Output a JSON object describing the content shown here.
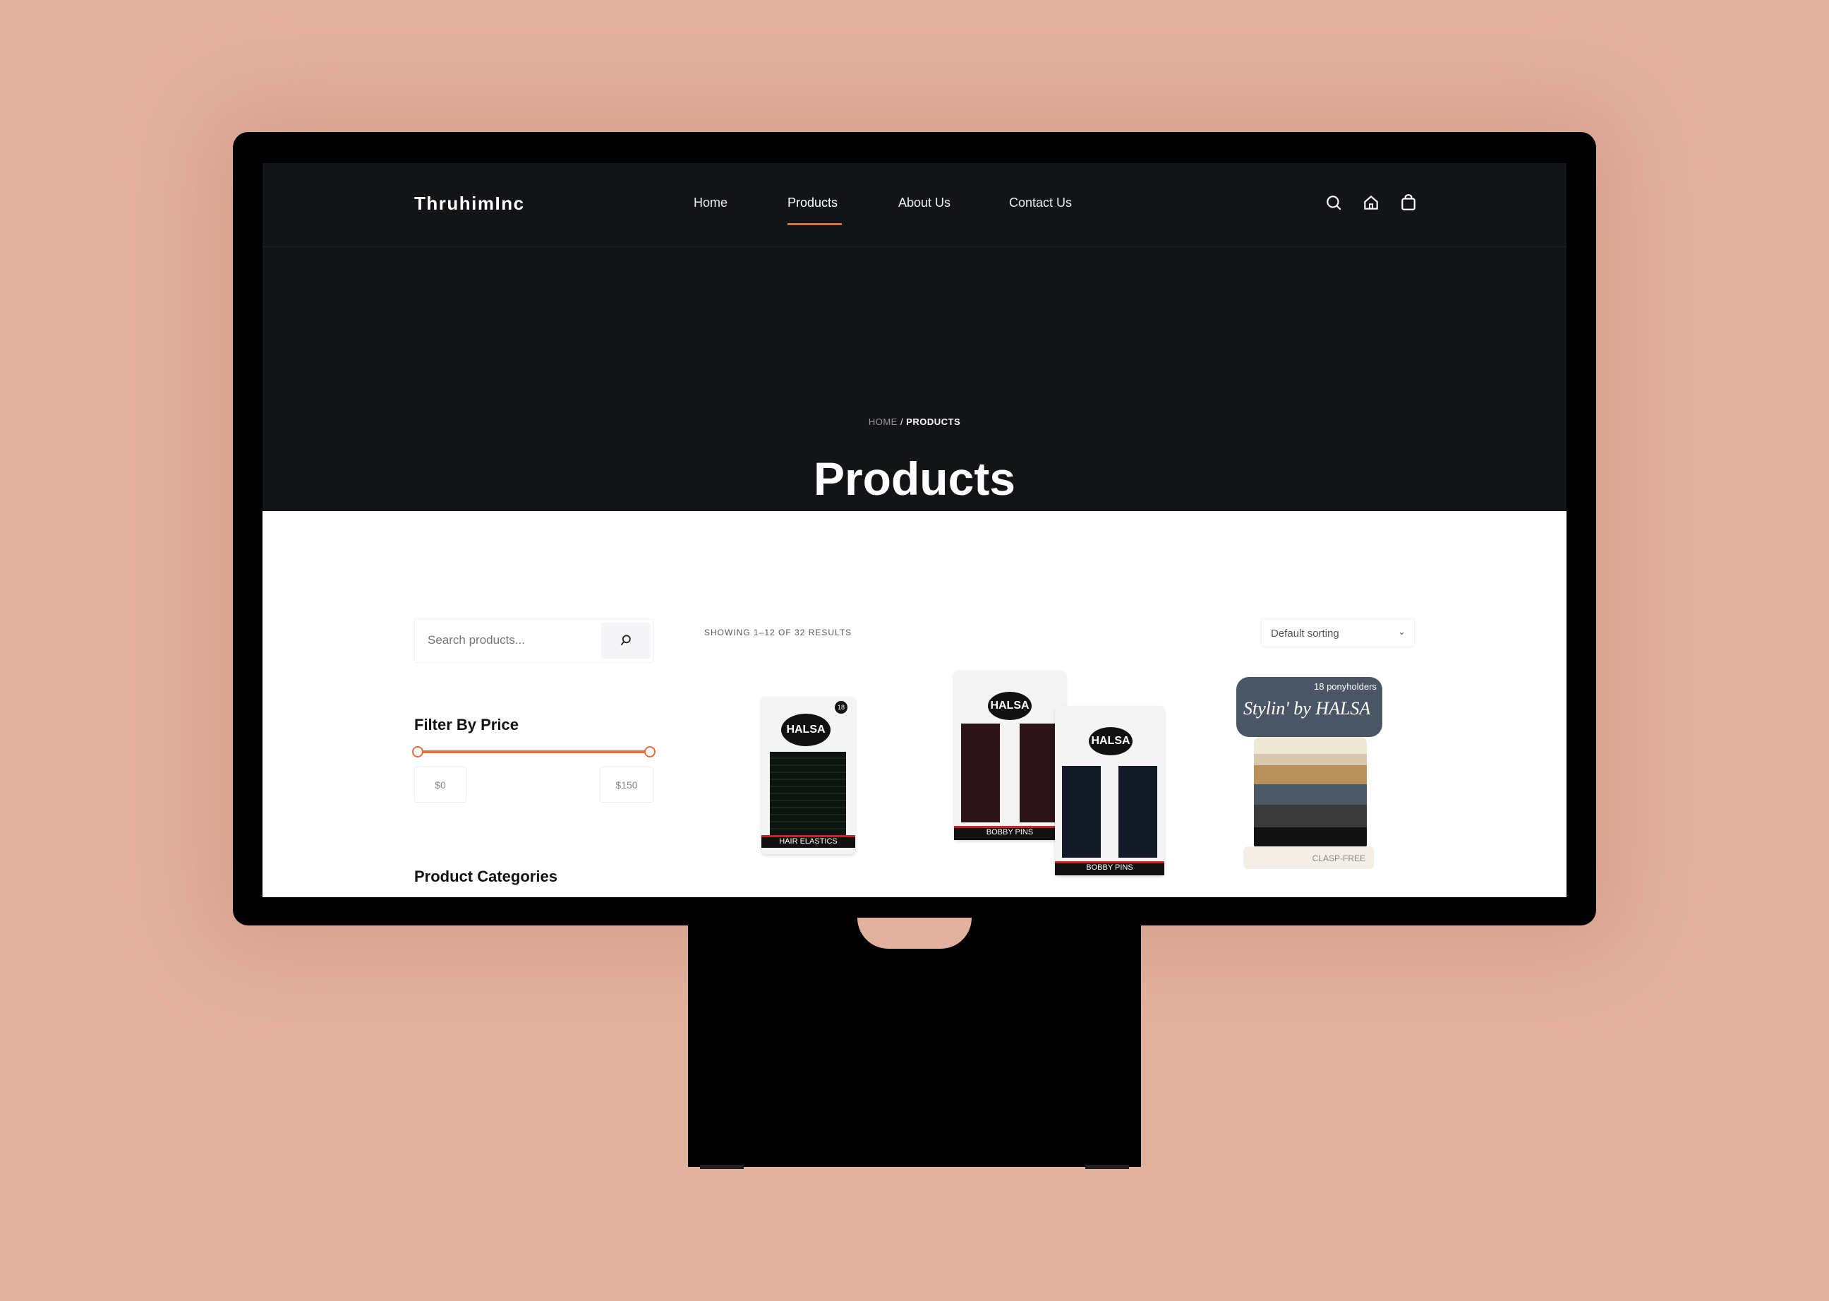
{
  "brand": "ThruhimInc",
  "nav": [
    {
      "label": "Home"
    },
    {
      "label": "Products",
      "active": true
    },
    {
      "label": "About Us"
    },
    {
      "label": "Contact Us"
    }
  ],
  "header_icons": [
    "search-icon",
    "home-icon",
    "shopping-bag-icon"
  ],
  "breadcrumb": {
    "home": "HOME",
    "sep": "/",
    "current": "PRODUCTS"
  },
  "page_title": "Products",
  "sidebar": {
    "search_placeholder": "Search products...",
    "filter_title": "Filter By Price",
    "price_min": "$0",
    "price_max": "$150",
    "categories_title": "Product Categories"
  },
  "results": "SHOWING 1–12 OF 32 RESULTS",
  "sort": {
    "selected": "Default sorting"
  },
  "products": [
    {
      "brand": "HALSA",
      "label": "HAIR ELASTICS",
      "count": "18"
    },
    {
      "brand": "HALSA",
      "label": "BOBBY PINS"
    },
    {
      "brand": "HALSA",
      "label": "CLASP-FREE",
      "title": "Stylin' by HALSA",
      "count": "18 ponyholders"
    }
  ],
  "colors": {
    "accent": "#e0703a",
    "dark": "#121417",
    "background": "#e3b29e"
  }
}
